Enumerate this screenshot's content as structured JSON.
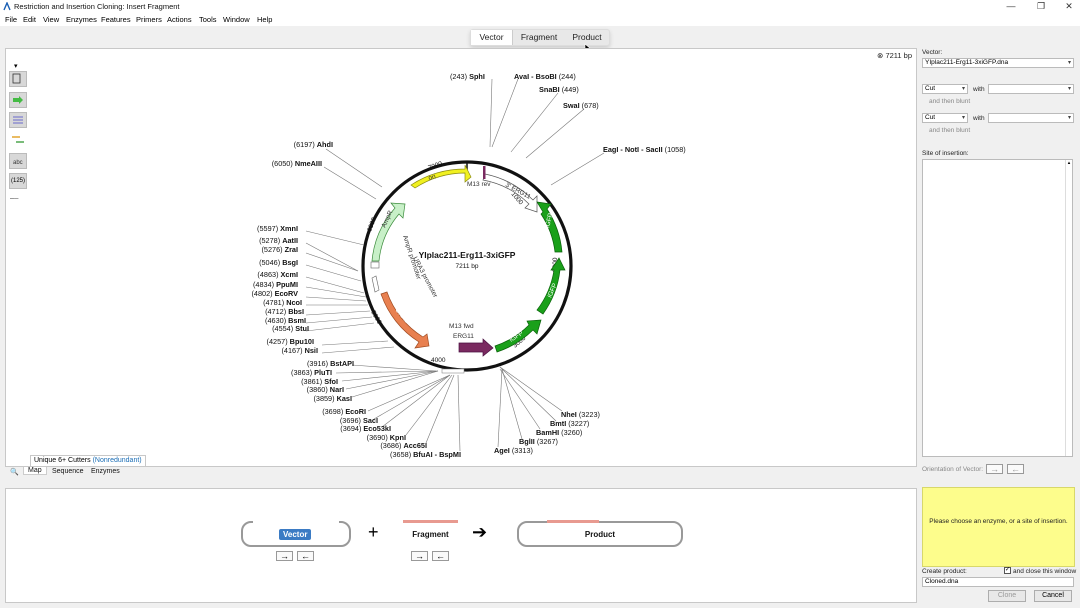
{
  "window": {
    "title": "Restriction and Insertion Cloning: Insert Fragment"
  },
  "menu": [
    "File",
    "Edit",
    "View",
    "Enzymes",
    "Features",
    "Primers",
    "Actions",
    "Tools",
    "Window",
    "Help"
  ],
  "tabs": [
    {
      "label": "Vector",
      "active": true
    },
    {
      "label": "Fragment",
      "active": false
    },
    {
      "label": "Product",
      "active": false
    }
  ],
  "map": {
    "bp_badge": "7211 bp",
    "plasmid_name": "YIplac211-Erg11-3xiGFP",
    "plasmid_size": "7211 bp",
    "ticks": [
      "1000",
      "2000",
      "3000",
      "4000",
      "5000",
      "6000",
      "7000"
    ],
    "features": {
      "ori": "ori",
      "ampr": "AmpR",
      "ampr_promoter": "AmpR promoter",
      "ura3_promoter": "URA3 promoter",
      "ura3": "URA3",
      "m13rev": "M13 rev",
      "erg11_top": "3' ERG11",
      "m13fwd": "M13 fwd",
      "erg11_bottom": "ERG11",
      "igfp1": "iGFP",
      "igfp2": "iGFP",
      "igfp3": "iGFP"
    },
    "sites": [
      {
        "pos": "(243)",
        "name": "SphI"
      },
      {
        "pos": "(244)",
        "name": "AvaI - BsoBI",
        "pos_after": true
      },
      {
        "pos": "(449)",
        "name": "SnaBI",
        "pos_after": true
      },
      {
        "pos": "(678)",
        "name": "SwaI",
        "pos_after": true
      },
      {
        "pos": "(1058)",
        "name": "EagI - NotI - SacII",
        "pos_after": true
      },
      {
        "pos": "(6197)",
        "name": "AhdI"
      },
      {
        "pos": "(6050)",
        "name": "NmeAIII"
      },
      {
        "pos": "(5597)",
        "name": "XmnI"
      },
      {
        "pos": "(5278)",
        "name": "AatII"
      },
      {
        "pos": "(5276)",
        "name": "ZraI"
      },
      {
        "pos": "(5046)",
        "name": "BsgI"
      },
      {
        "pos": "(4863)",
        "name": "XcmI"
      },
      {
        "pos": "(4834)",
        "name": "PpuMI"
      },
      {
        "pos": "(4802)",
        "name": "EcoRV"
      },
      {
        "pos": "(4781)",
        "name": "NcoI"
      },
      {
        "pos": "(4712)",
        "name": "BbsI"
      },
      {
        "pos": "(4630)",
        "name": "BsmI"
      },
      {
        "pos": "(4554)",
        "name": "StuI"
      },
      {
        "pos": "(4257)",
        "name": "Bpu10I"
      },
      {
        "pos": "(4167)",
        "name": "NsiI"
      },
      {
        "pos": "(3916)",
        "name": "BstAPI"
      },
      {
        "pos": "(3863)",
        "name": "PluTI"
      },
      {
        "pos": "(3861)",
        "name": "SfoI"
      },
      {
        "pos": "(3860)",
        "name": "NarI"
      },
      {
        "pos": "(3859)",
        "name": "KasI"
      },
      {
        "pos": "(3698)",
        "name": "EcoRI"
      },
      {
        "pos": "(3696)",
        "name": "SacI"
      },
      {
        "pos": "(3694)",
        "name": "Eco53kI"
      },
      {
        "pos": "(3690)",
        "name": "KpnI"
      },
      {
        "pos": "(3686)",
        "name": "Acc65I"
      },
      {
        "pos": "(3658)",
        "name": "BfuAI - BspMI"
      },
      {
        "pos": "(3223)",
        "name": "NheI",
        "pos_after": true
      },
      {
        "pos": "(3227)",
        "name": "BmtI",
        "pos_after": true
      },
      {
        "pos": "(3260)",
        "name": "BamHI",
        "pos_after": true
      },
      {
        "pos": "(3267)",
        "name": "BglII",
        "pos_after": true
      },
      {
        "pos": "(3313)",
        "name": "AgeI",
        "pos_after": true
      }
    ],
    "cutters_tab": {
      "text": "Unique 6+ Cutters",
      "qualifier": "(Nonredundant)"
    },
    "bottom_tabs": [
      "Map",
      "Sequence",
      "Enzymes"
    ],
    "tool_zoom": "(125)"
  },
  "cloning": {
    "vector_label": "Vector",
    "fragment_label": "Fragment",
    "product_label": "Product",
    "plus": "+",
    "arrow": "➔",
    "fwd_arrow": "→",
    "rev_arrow": "←"
  },
  "right": {
    "vector_label": "Vector:",
    "vector_value": "YIplac211-Erg11-3xiGFP.dna",
    "cut1": "Cut",
    "with1": "with",
    "then_blunt1": "and then blunt",
    "cut2": "Cut",
    "with2": "with",
    "then_blunt2": "and then blunt",
    "site_label": "Site of insertion:",
    "orientation_label": "Orientation of Vector:",
    "note": "Please choose an enzyme, or a site of insertion.",
    "create_label": "Create product:",
    "close_checkbox": "and close this window",
    "product_name": "Cloned.dna",
    "clone_btn": "Clone",
    "cancel_btn": "Cancel"
  },
  "colors": {
    "ori": "#f0f020",
    "ampr": "#c8f0c8",
    "ura3": "#e88050",
    "igfp": "#1aa01a",
    "erg11": "#7a2a60",
    "note_bg": "#fdfd8c",
    "accent": "#3b7bc4"
  }
}
